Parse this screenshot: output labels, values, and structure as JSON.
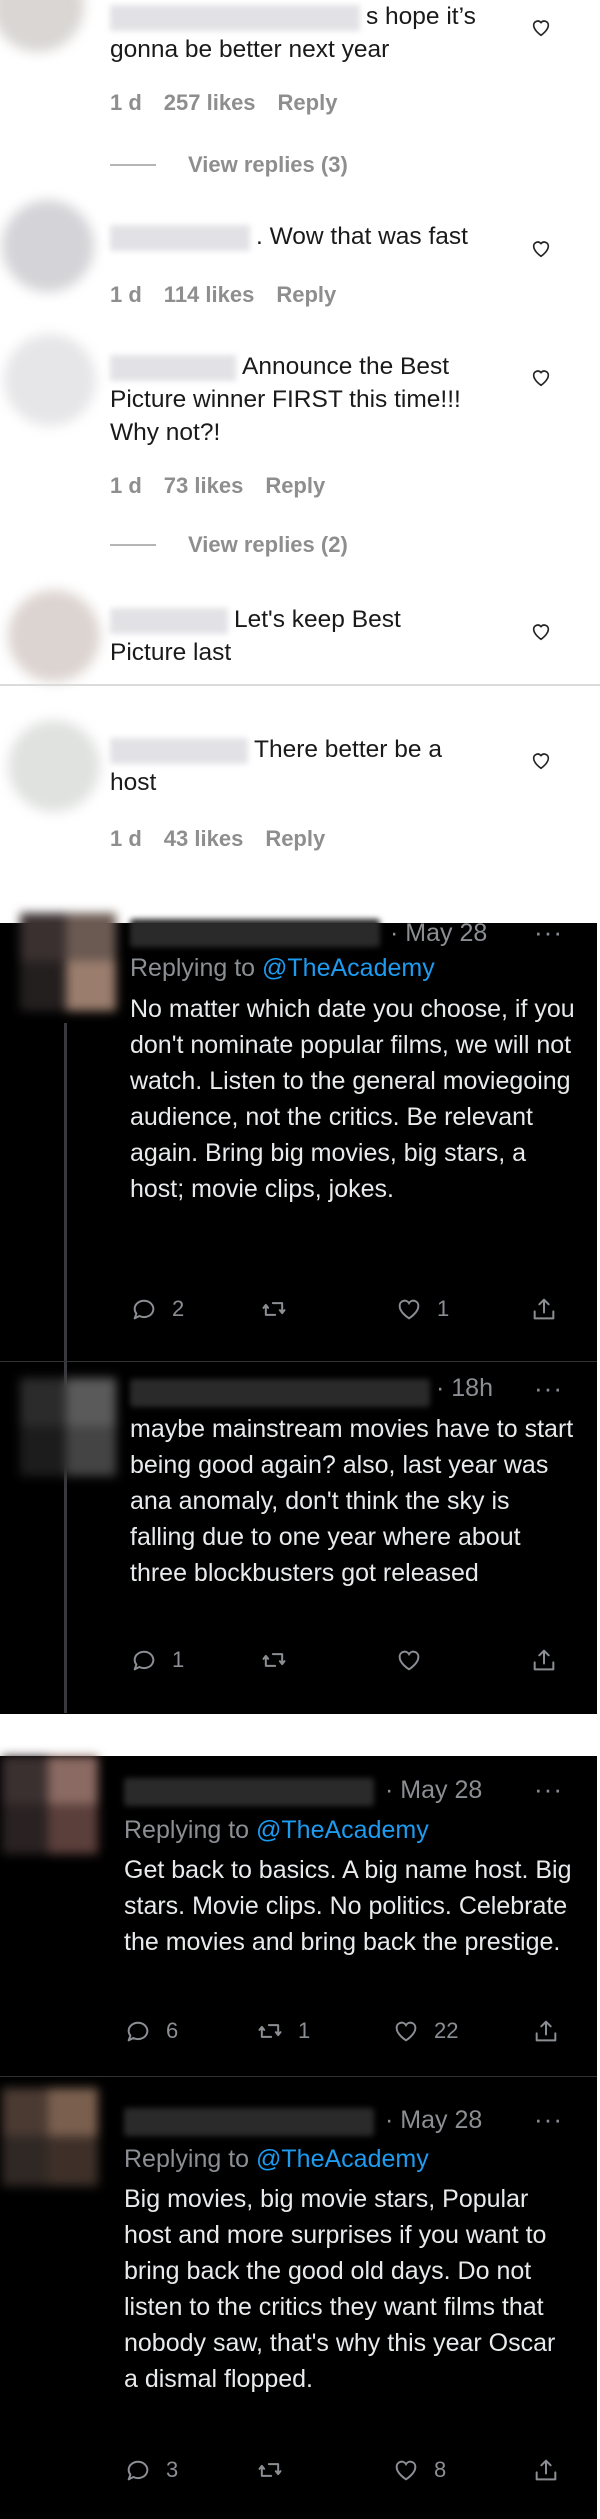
{
  "instagram": {
    "comments": [
      {
        "text_tail": "s hope it’s",
        "text_line2": "gonna be better next year",
        "time": "1 d",
        "likes": "257 likes",
        "reply": "Reply",
        "view_replies": "View replies (3)"
      },
      {
        "text_tail": ". Wow that was fast",
        "time": "1 d",
        "likes": "114 likes",
        "reply": "Reply"
      },
      {
        "text_line1": "Announce the Best",
        "text_line2": "Picture winner FIRST this time!!!",
        "text_line3": "Why not?!",
        "time": "1 d",
        "likes": "73 likes",
        "reply": "Reply",
        "view_replies": "View replies (2)"
      },
      {
        "text_line1": "Let's keep Best",
        "text_line2": "Picture last"
      },
      {
        "text_line1": "There better be a",
        "text_line2": "host",
        "time": "1 d",
        "likes": "43 likes",
        "reply": "Reply"
      }
    ]
  },
  "twitter": {
    "tweets": [
      {
        "date": "· May 28",
        "dots": "···",
        "replying_prefix": "Replying to ",
        "replying_handle": "@TheAcademy",
        "body": "No matter which date you choose, if you don't nominate popular films, we will not watch. Listen to the general moviegoing audience, not the critics. Be relevant again. Bring big movies, big stars, a host; movie clips, jokes.",
        "replies": "2",
        "retweets": "",
        "likes": "1"
      },
      {
        "date": "· 18h",
        "dots": "···",
        "body": "maybe mainstream movies have to start being good again? also, last year was ana anomaly, don't think the sky is falling due to one year where about three blockbusters got released",
        "replies": "1",
        "retweets": "",
        "likes": ""
      },
      {
        "date": "· May 28",
        "dots": "···",
        "replying_prefix": "Replying to ",
        "replying_handle": "@TheAcademy",
        "body": "Get back to basics. A big name host. Big stars. Movie clips. No politics. Celebrate the movies and bring back the prestige.",
        "replies": "6",
        "retweets": "1",
        "likes": "22"
      },
      {
        "date": "· May 28",
        "dots": "···",
        "replying_prefix": "Replying to ",
        "replying_handle": "@TheAcademy",
        "body": "Big movies, big movie stars, Popular host and more surprises if you want to bring back the good old days. Do not listen to the critics they want films that nobody saw, that's why this year Oscar a dismal flopped.",
        "replies": "3",
        "retweets": "",
        "likes": "8"
      }
    ]
  },
  "colors": {
    "link": "#1d9bf0",
    "muted": "#8b8f94",
    "ig_muted": "#8e8e8e"
  }
}
